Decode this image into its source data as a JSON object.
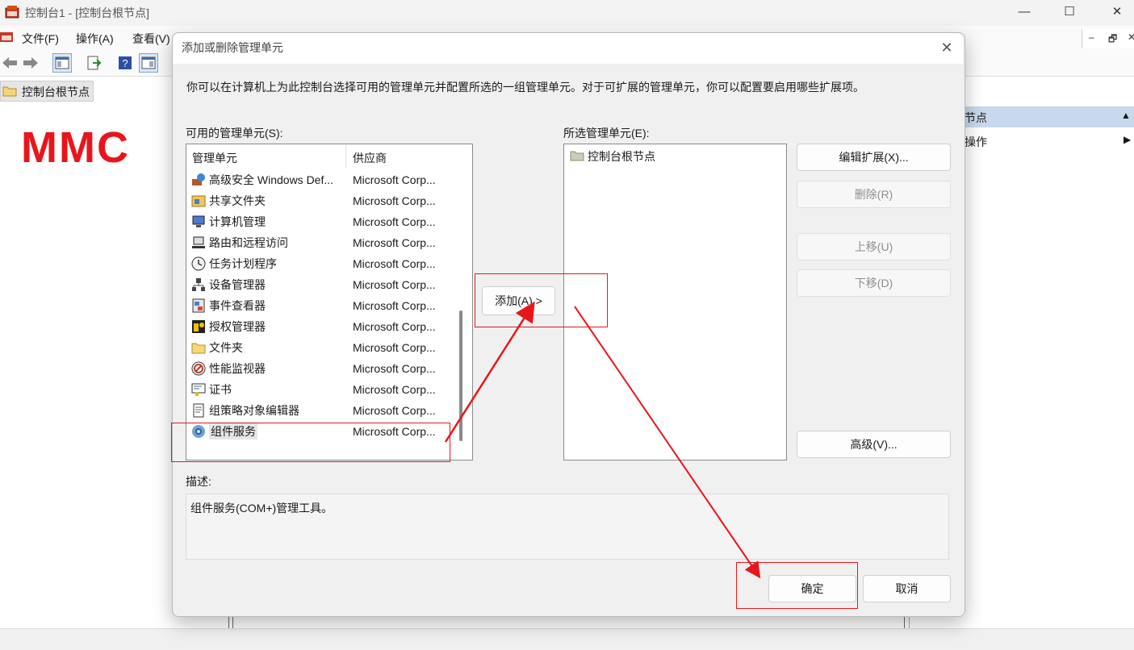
{
  "window": {
    "title": "控制台1 - [控制台根节点]",
    "minimize": "—",
    "maximize": "☐",
    "close": "✕"
  },
  "menu": {
    "file": "文件(F)",
    "action": "操作(A)",
    "view": "查看(V)"
  },
  "tree": {
    "root": "控制台根节点"
  },
  "annotation": {
    "mmc": "MMC"
  },
  "actions_pane": {
    "header": "节点",
    "item": "操作"
  },
  "dialog": {
    "title": "添加或删除管理单元",
    "intro": "你可以在计算机上为此控制台选择可用的管理单元并配置所选的一组管理单元。对于可扩展的管理单元，你可以配置要启用哪些扩展项。",
    "available_label": "可用的管理单元(S):",
    "columns": {
      "snapin": "管理单元",
      "vendor": "供应商"
    },
    "available": [
      {
        "name": "高级安全 Windows Def...",
        "vendor": "Microsoft Corp...",
        "icon": "firewall-icon"
      },
      {
        "name": "共享文件夹",
        "vendor": "Microsoft Corp...",
        "icon": "shared-folder-icon"
      },
      {
        "name": "计算机管理",
        "vendor": "Microsoft Corp...",
        "icon": "computer-management-icon"
      },
      {
        "name": "路由和远程访问",
        "vendor": "Microsoft Corp...",
        "icon": "routing-icon"
      },
      {
        "name": "任务计划程序",
        "vendor": "Microsoft Corp...",
        "icon": "clock-icon"
      },
      {
        "name": "设备管理器",
        "vendor": "Microsoft Corp...",
        "icon": "device-manager-icon"
      },
      {
        "name": "事件查看器",
        "vendor": "Microsoft Corp...",
        "icon": "event-viewer-icon"
      },
      {
        "name": "授权管理器",
        "vendor": "Microsoft Corp...",
        "icon": "authorization-icon"
      },
      {
        "name": "文件夹",
        "vendor": "Microsoft Corp...",
        "icon": "folder-icon"
      },
      {
        "name": "性能监视器",
        "vendor": "Microsoft Corp...",
        "icon": "performance-icon"
      },
      {
        "name": "证书",
        "vendor": "Microsoft Corp...",
        "icon": "certificate-icon"
      },
      {
        "name": "组策略对象编辑器",
        "vendor": "Microsoft Corp...",
        "icon": "group-policy-icon"
      },
      {
        "name": "组件服务",
        "vendor": "Microsoft Corp...",
        "icon": "component-services-icon",
        "selected": true
      }
    ],
    "add_button": "添加(A) >",
    "selected_label": "所选管理单元(E):",
    "selected_item": "控制台根节点",
    "buttons": {
      "edit_extensions": "编辑扩展(X)...",
      "remove": "删除(R)",
      "move_up": "上移(U)",
      "move_down": "下移(D)",
      "advanced": "高级(V)...",
      "ok": "确定",
      "cancel": "取消"
    },
    "description_label": "描述:",
    "description": "组件服务(COM+)管理工具。"
  },
  "colors": {
    "annotation_red": "#e8161b",
    "actions_header": "#c8d9ee",
    "dialog_bg": "#f0f0f0"
  }
}
